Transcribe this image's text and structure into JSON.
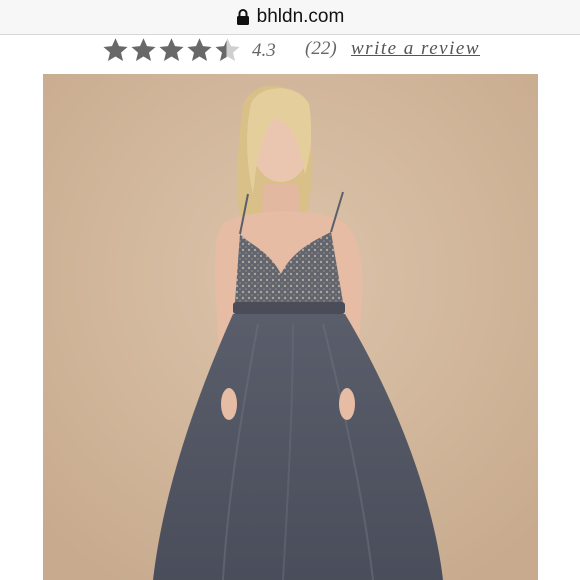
{
  "browser": {
    "domain": "bhldn.com",
    "lock_icon": "lock-icon"
  },
  "product": {
    "rating": {
      "stars_filled": 4.3,
      "stars_total": 5,
      "score": "4.3",
      "count": "(22)",
      "write_review_label": "write a review"
    },
    "image": {
      "icon": "product-photo",
      "description_colors": {
        "backdrop": "#d2b79c",
        "dress": "#545865",
        "skin": "#e8c4ae",
        "hair": "#e2cc98"
      }
    }
  },
  "colors": {
    "star": "#686868",
    "star_empty": "#cfcfcf",
    "rating_text": "#666666",
    "url_bar": "#f7f7f7"
  }
}
